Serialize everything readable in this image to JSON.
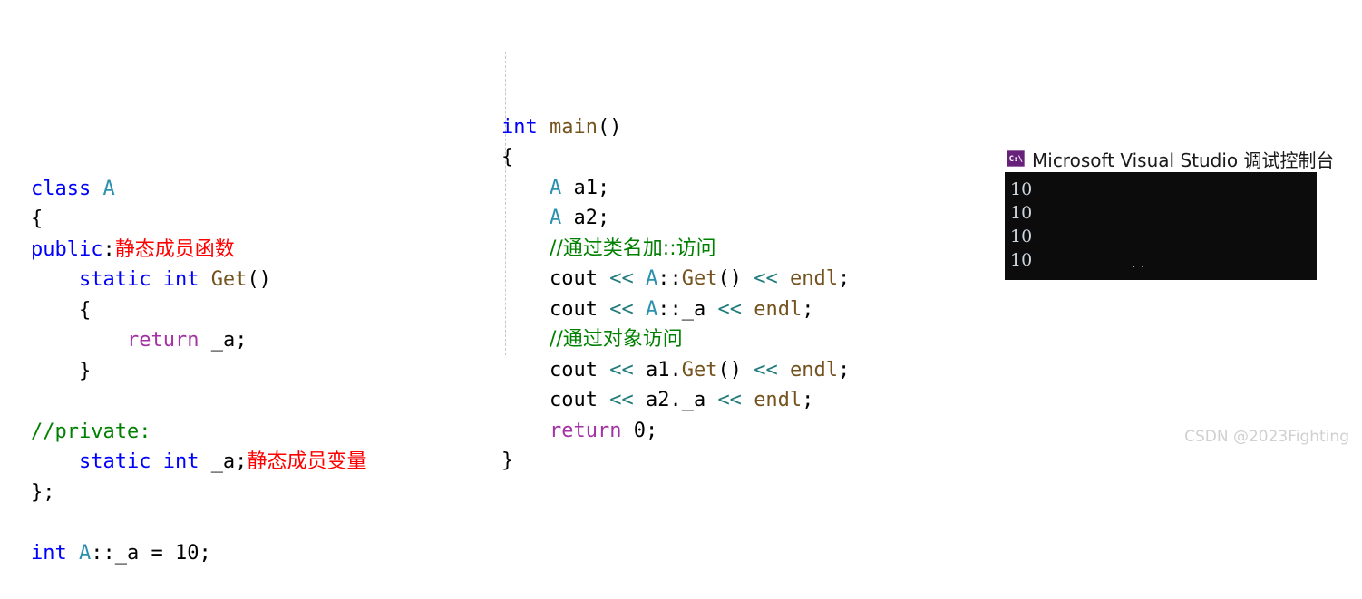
{
  "left_code": {
    "lines": [
      {
        "id": "l1",
        "tokens": [
          {
            "t": "class ",
            "c": "kw"
          },
          {
            "t": "A",
            "c": "type"
          }
        ]
      },
      {
        "id": "l2",
        "tokens": [
          {
            "t": "{",
            "c": "pun"
          }
        ]
      },
      {
        "id": "l3",
        "tokens": [
          {
            "t": "public",
            "c": "kw"
          },
          {
            "t": ":",
            "c": "pun"
          },
          {
            "t": "静态成员函数",
            "c": "note"
          }
        ]
      },
      {
        "id": "l4",
        "tokens": [
          {
            "t": "    ",
            "c": "pun"
          },
          {
            "t": "static int ",
            "c": "kw"
          },
          {
            "t": "Get",
            "c": "fn"
          },
          {
            "t": "()",
            "c": "pun"
          }
        ]
      },
      {
        "id": "l5",
        "tokens": [
          {
            "t": "    {",
            "c": "pun"
          }
        ]
      },
      {
        "id": "l6",
        "tokens": [
          {
            "t": "        ",
            "c": "pun"
          },
          {
            "t": "return",
            "c": "ctrl"
          },
          {
            "t": " _a;",
            "c": "pun"
          }
        ]
      },
      {
        "id": "l7",
        "tokens": [
          {
            "t": "    }",
            "c": "pun"
          }
        ]
      },
      {
        "id": "l8",
        "tokens": []
      },
      {
        "id": "l9",
        "tokens": [
          {
            "t": "//private:",
            "c": "cmt"
          }
        ]
      },
      {
        "id": "l10",
        "tokens": [
          {
            "t": "    ",
            "c": "pun"
          },
          {
            "t": "static int ",
            "c": "kw"
          },
          {
            "t": "_a;",
            "c": "pun"
          },
          {
            "t": "静态成员变量",
            "c": "note"
          }
        ]
      },
      {
        "id": "l11",
        "tokens": [
          {
            "t": "};",
            "c": "pun"
          }
        ]
      },
      {
        "id": "l12",
        "tokens": []
      },
      {
        "id": "l13",
        "tokens": [
          {
            "t": "int ",
            "c": "kw"
          },
          {
            "t": "A",
            "c": "type"
          },
          {
            "t": "::_a = 10;",
            "c": "pun"
          }
        ]
      }
    ]
  },
  "right_code": {
    "lines": [
      {
        "id": "r1",
        "tokens": [
          {
            "t": "int ",
            "c": "kw"
          },
          {
            "t": "main",
            "c": "fn"
          },
          {
            "t": "()",
            "c": "pun"
          }
        ]
      },
      {
        "id": "r2",
        "tokens": [
          {
            "t": "{",
            "c": "pun"
          }
        ]
      },
      {
        "id": "r3",
        "tokens": [
          {
            "t": "    ",
            "c": "pun"
          },
          {
            "t": "A",
            "c": "type"
          },
          {
            "t": " a1;",
            "c": "pun"
          }
        ]
      },
      {
        "id": "r4",
        "tokens": [
          {
            "t": "    ",
            "c": "pun"
          },
          {
            "t": "A",
            "c": "type"
          },
          {
            "t": " a2;",
            "c": "pun"
          }
        ]
      },
      {
        "id": "r5",
        "tokens": [
          {
            "t": "    ",
            "c": "pun"
          },
          {
            "t": "//通过类名加::访问",
            "c": "cmt"
          }
        ]
      },
      {
        "id": "r6",
        "tokens": [
          {
            "t": "    cout ",
            "c": "pun"
          },
          {
            "t": "<<",
            "c": "op"
          },
          {
            "t": " ",
            "c": "pun"
          },
          {
            "t": "A",
            "c": "type"
          },
          {
            "t": "::",
            "c": "pun"
          },
          {
            "t": "Get",
            "c": "fn"
          },
          {
            "t": "() ",
            "c": "pun"
          },
          {
            "t": "<<",
            "c": "op"
          },
          {
            "t": " ",
            "c": "pun"
          },
          {
            "t": "endl",
            "c": "fn"
          },
          {
            "t": ";",
            "c": "pun"
          }
        ]
      },
      {
        "id": "r7",
        "tokens": [
          {
            "t": "    cout ",
            "c": "pun"
          },
          {
            "t": "<<",
            "c": "op"
          },
          {
            "t": " ",
            "c": "pun"
          },
          {
            "t": "A",
            "c": "type"
          },
          {
            "t": "::_a ",
            "c": "pun"
          },
          {
            "t": "<<",
            "c": "op"
          },
          {
            "t": " ",
            "c": "pun"
          },
          {
            "t": "endl",
            "c": "fn"
          },
          {
            "t": ";",
            "c": "pun"
          }
        ]
      },
      {
        "id": "r8",
        "tokens": [
          {
            "t": "    ",
            "c": "pun"
          },
          {
            "t": "//通过对象访问",
            "c": "cmt"
          }
        ]
      },
      {
        "id": "r9",
        "tokens": [
          {
            "t": "    cout ",
            "c": "pun"
          },
          {
            "t": "<<",
            "c": "op"
          },
          {
            "t": " a1.",
            "c": "pun"
          },
          {
            "t": "Get",
            "c": "fn"
          },
          {
            "t": "() ",
            "c": "pun"
          },
          {
            "t": "<<",
            "c": "op"
          },
          {
            "t": " ",
            "c": "pun"
          },
          {
            "t": "endl",
            "c": "fn"
          },
          {
            "t": ";",
            "c": "pun"
          }
        ]
      },
      {
        "id": "r10",
        "tokens": [
          {
            "t": "    cout ",
            "c": "pun"
          },
          {
            "t": "<<",
            "c": "op"
          },
          {
            "t": " a2._a ",
            "c": "pun"
          },
          {
            "t": "<<",
            "c": "op"
          },
          {
            "t": " ",
            "c": "pun"
          },
          {
            "t": "endl",
            "c": "fn"
          },
          {
            "t": ";",
            "c": "pun"
          }
        ]
      },
      {
        "id": "r11",
        "tokens": [
          {
            "t": "    ",
            "c": "pun"
          },
          {
            "t": "return",
            "c": "ctrl"
          },
          {
            "t": " 0;",
            "c": "pun"
          }
        ]
      },
      {
        "id": "r12",
        "tokens": [
          {
            "t": "}",
            "c": "pun"
          }
        ]
      }
    ]
  },
  "console": {
    "app_icon_label": "C:\\",
    "icon_name": "command-prompt-icon",
    "title": "Microsoft Visual Studio 调试控制台",
    "output_lines": [
      "10",
      "10",
      "10",
      "10"
    ],
    "background": "#0c0c0c",
    "text_color": "#cdd5de",
    "artifact": "··"
  },
  "watermark": {
    "text": "CSDN @2023Fighting"
  },
  "palette": {
    "keyword": "#0000ff",
    "class_type": "#2b91af",
    "function": "#74531f",
    "control": "#a432a4",
    "operator": "#1f7a7a",
    "comment": "#008000",
    "annotation": "#ff0000",
    "plain": "#000000"
  }
}
